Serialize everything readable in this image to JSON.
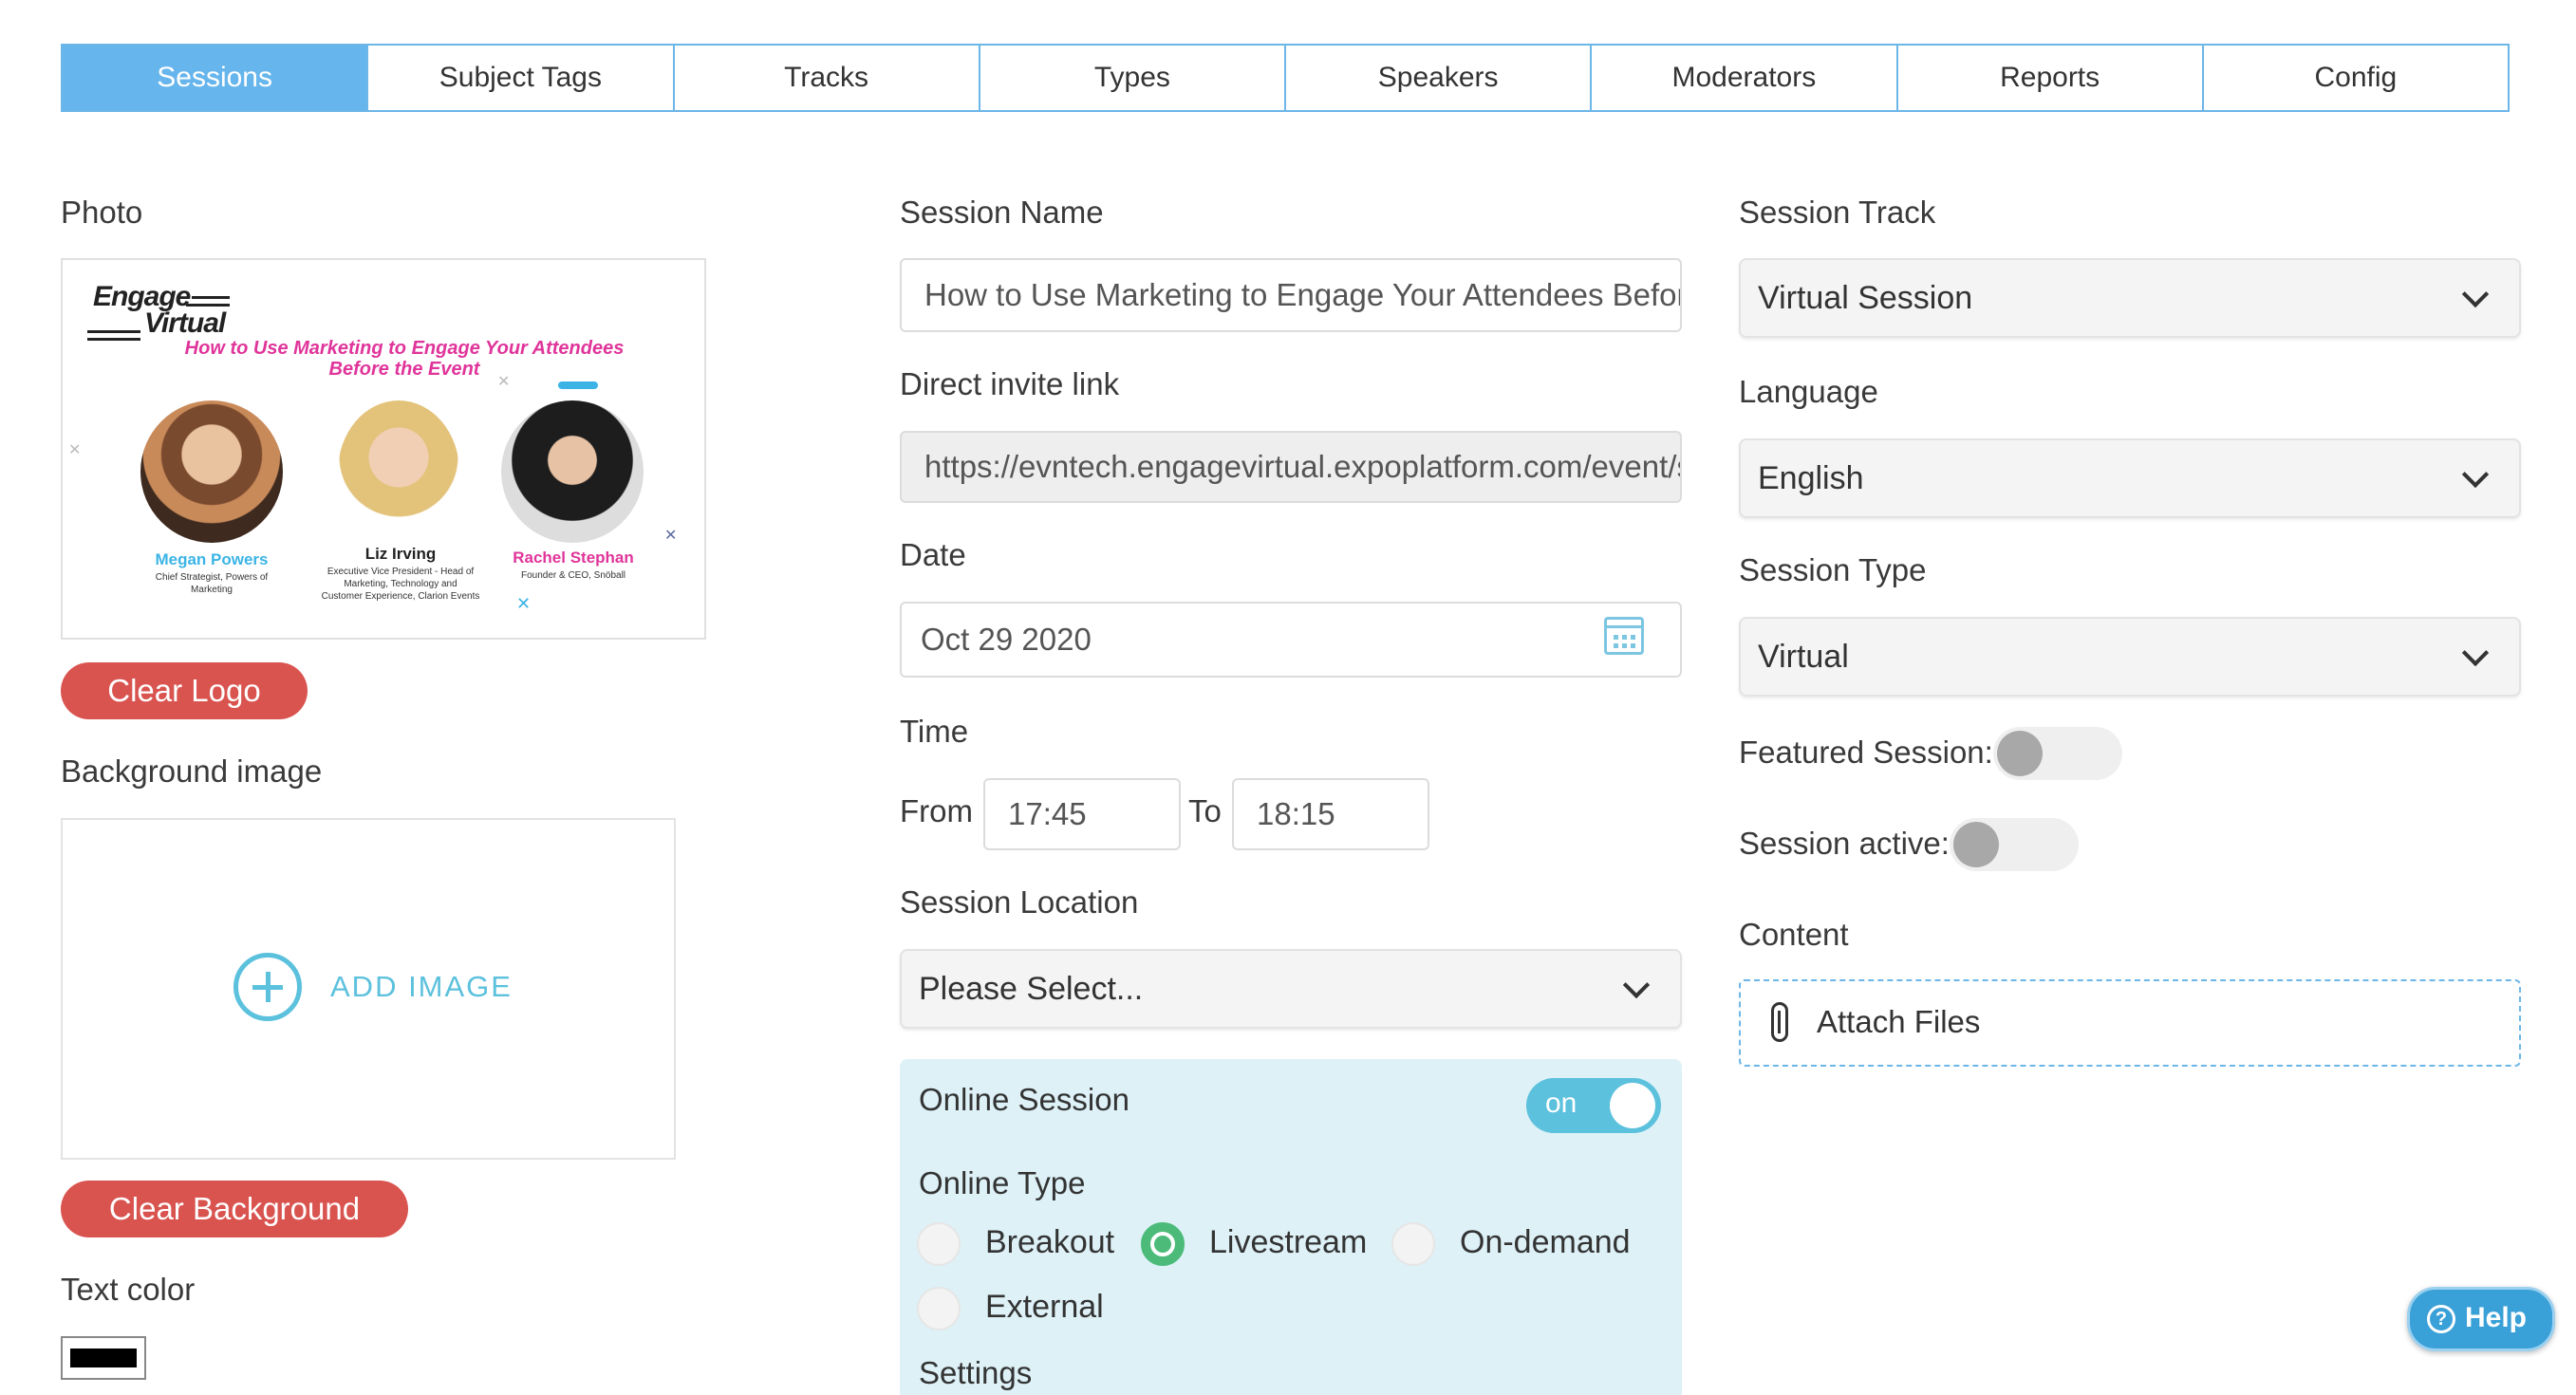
{
  "tabs": [
    {
      "label": "Sessions",
      "active": true
    },
    {
      "label": "Subject Tags"
    },
    {
      "label": "Tracks"
    },
    {
      "label": "Types"
    },
    {
      "label": "Speakers"
    },
    {
      "label": "Moderators"
    },
    {
      "label": "Reports"
    },
    {
      "label": "Config"
    }
  ],
  "left": {
    "photo_label": "Photo",
    "photo": {
      "brand_line1": "Engage",
      "brand_line2": "Virtual",
      "headline_line1": "How to Use Marketing to Engage Your Attendees",
      "headline_line2": "Before the Event",
      "speakers": [
        {
          "name": "Megan Powers",
          "title_line1": "Chief Strategist, Powers of",
          "title_line2": "Marketing",
          "title_line3": "",
          "color": "#3bb4e5"
        },
        {
          "name": "Liz Irving",
          "title_line1": "Executive Vice President - Head of",
          "title_line2": "Marketing, Technology and",
          "title_line3": "Customer Experience, Clarion Events",
          "color": "#222222"
        },
        {
          "name": "Rachel Stephan",
          "title_line1": "Founder & CEO, Snöball",
          "title_line2": "",
          "title_line3": "",
          "color": "#e0349a"
        }
      ]
    },
    "clear_logo": "Clear Logo",
    "bg_label": "Background image",
    "add_image": "ADD IMAGE",
    "clear_bg": "Clear Background",
    "text_color_label": "Text color",
    "text_color_value": "#000000"
  },
  "middle": {
    "session_name_label": "Session Name",
    "session_name_value": "How to Use Marketing to Engage Your Attendees Before the Event",
    "invite_label": "Direct invite link",
    "invite_value": "https://evntech.engagevirtual.expoplatform.com/event/session",
    "date_label": "Date",
    "date_value": "Oct 29 2020",
    "time_label": "Time",
    "from_label": "From",
    "from_value": "17:45",
    "to_label": "To",
    "to_value": "18:15",
    "location_label": "Session Location",
    "location_value": "Please Select...",
    "online": {
      "title": "Online Session",
      "toggle_label": "on",
      "type_label": "Online Type",
      "options": [
        "Breakout",
        "Livestream",
        "On-demand",
        "External"
      ],
      "selected": "Livestream",
      "settings_label": "Settings"
    }
  },
  "right": {
    "track_label": "Session Track",
    "track_value": "Virtual Session",
    "language_label": "Language",
    "language_value": "English",
    "type_label": "Session Type",
    "type_value": "Virtual",
    "featured_label": "Featured Session:",
    "active_label": "Session active:",
    "content_label": "Content",
    "attach_label": "Attach Files"
  },
  "help_label": "Help",
  "colors": {
    "accent": "#66b5ec",
    "danger": "#d9534f",
    "online_panel": "#ddf1f7",
    "toggle_on": "#5cc1dd",
    "radio_checked": "#4cbb7a"
  }
}
